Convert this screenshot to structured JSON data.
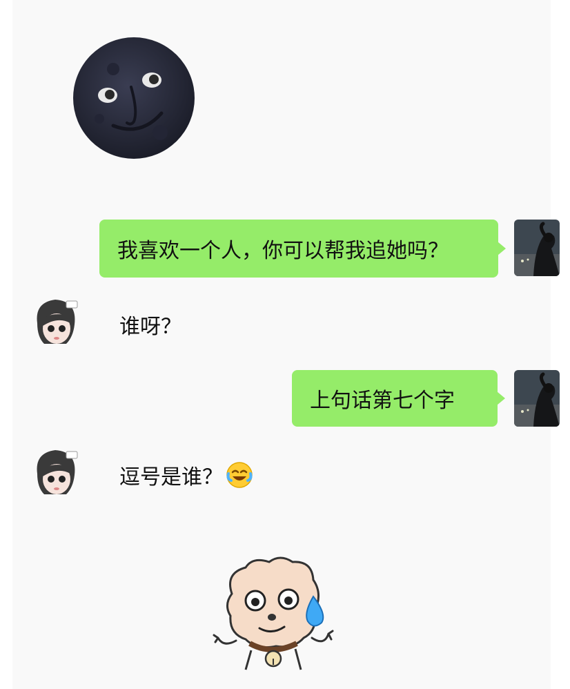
{
  "messages": [
    {
      "from": "sticker",
      "sticker": "moon-face-icon"
    },
    {
      "from": "me",
      "text": "我喜欢一个人，你可以帮我追她吗？"
    },
    {
      "from": "her",
      "text": "谁呀？"
    },
    {
      "from": "me",
      "text": "上句话第七个字"
    },
    {
      "from": "her",
      "text": "逗号是谁？",
      "emoji": "laughing-crying-icon"
    },
    {
      "from": "sticker",
      "sticker": "sweating-sheep-icon"
    }
  ],
  "colors": {
    "bubble_out": "#95ec69",
    "background": "#f9f9f9",
    "moon": "#2b2d3c"
  }
}
